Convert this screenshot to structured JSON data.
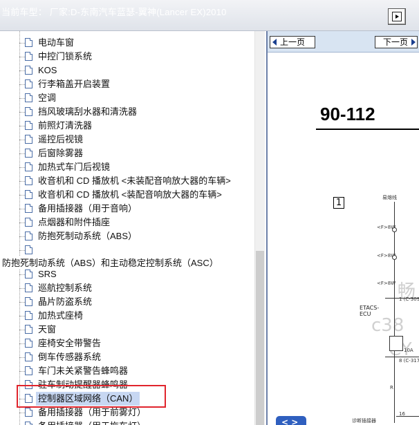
{
  "window": {
    "title": "当前车型： 厂家:D-东南汽车蓝瑟-翼神(Lancer EX)2010"
  },
  "tree": {
    "items": [
      {
        "label": "电动车窗"
      },
      {
        "label": "中控门锁系统"
      },
      {
        "label": "KOS"
      },
      {
        "label": "行李箱盖开启装置"
      },
      {
        "label": "空调"
      },
      {
        "label": "挡风玻璃刮水器和清洗器"
      },
      {
        "label": "前照灯清洗器"
      },
      {
        "label": "遥控后视镜"
      },
      {
        "label": "后窗除雾器"
      },
      {
        "label": "加热式车门后视镜"
      },
      {
        "label": "收音机和 CD 播放机 <未装配音响放大器的车辆>"
      },
      {
        "label": "收音机和 CD 播放机 <装配音响放大器的车辆>"
      },
      {
        "label": "备用插接器（用于音响）"
      },
      {
        "label": "点烟器和附件插座"
      },
      {
        "label": "防抱死制动系统（ABS）"
      },
      {
        "label": ""
      },
      {
        "label": "防抱死制动系统（ABS）和主动稳定控制系统（ASC）"
      },
      {
        "label": "SRS"
      },
      {
        "label": "巡航控制系统"
      },
      {
        "label": "晶片防盗系统"
      },
      {
        "label": "加热式座椅"
      },
      {
        "label": "天窗"
      },
      {
        "label": "座椅安全带警告"
      },
      {
        "label": "倒车传感器系统"
      },
      {
        "label": "车门未关紧警告蜂鸣器"
      },
      {
        "label": "驻车制动提醒器蜂鸣器"
      },
      {
        "label": "控制器区域网络（CAN）"
      },
      {
        "label": "备用插接器（用于前雾灯）"
      },
      {
        "label": "备用插接器（用于拖车灯）"
      }
    ]
  },
  "viewer": {
    "prev_label": "上一页",
    "next_label": "下一页",
    "page_number": "90-112",
    "box_number": "1",
    "fuse_label": "易熔线",
    "labels": [
      "<F>8W",
      "<F>8W",
      "<F>8W",
      "1 (C-309)",
      "ETACS-ECU",
      "10A",
      "8 (C-317)",
      "R",
      "16",
      "诊断插接器",
      "C-26"
    ],
    "watermark": [
      "畅",
      "c38",
      "CY"
    ],
    "bottom_button": "<  >"
  },
  "colors": {
    "highlight": "#e0242c",
    "selection": "#c7d7f2",
    "navbar": "#d8e4f2"
  }
}
